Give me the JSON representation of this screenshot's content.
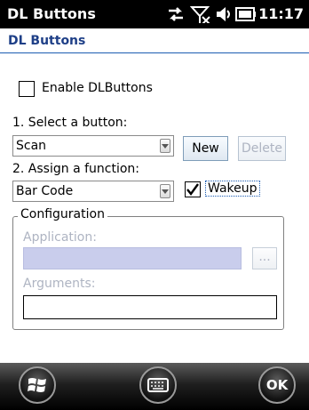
{
  "statusbar": {
    "title": "DL Buttons",
    "time": "11:17",
    "icons": [
      "connectivity-icon",
      "signal-off-icon",
      "volume-icon",
      "battery-icon"
    ]
  },
  "header": {
    "title": "DL Buttons"
  },
  "enable": {
    "label": "Enable DLButtons",
    "checked": false
  },
  "select": {
    "label": "1. Select a button:",
    "value": "Scan",
    "new_label": "New",
    "delete_label": "Delete"
  },
  "assign": {
    "label": "2. Assign a function:",
    "value": "Bar Code",
    "wakeup_label": "Wakeup",
    "wakeup_checked": true
  },
  "config": {
    "title": "Configuration",
    "application_label": "Application:",
    "application_value": "",
    "browse_label": "...",
    "arguments_label": "Arguments:",
    "arguments_value": ""
  },
  "bottombar": {
    "start_icon": "windows-start-icon",
    "keyboard_icon": "keyboard-icon",
    "ok_label": "OK"
  },
  "colors": {
    "header_text": "#1e3f87",
    "header_line": "#1b5cb2",
    "disabled_text": "#aeb4c2",
    "disabled_field": "#c9cdec"
  }
}
